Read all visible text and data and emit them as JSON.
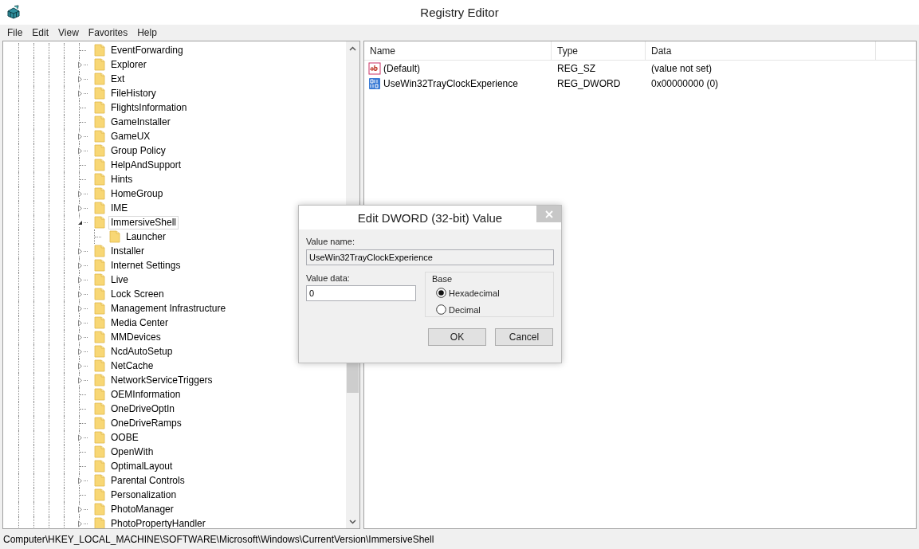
{
  "window": {
    "title": "Registry Editor"
  },
  "menu": [
    "File",
    "Edit",
    "View",
    "Favorites",
    "Help"
  ],
  "tree": {
    "items": [
      {
        "label": "EventForwarding",
        "expandable": false,
        "selected": false
      },
      {
        "label": "Explorer",
        "expandable": true,
        "selected": false
      },
      {
        "label": "Ext",
        "expandable": true,
        "selected": false
      },
      {
        "label": "FileHistory",
        "expandable": true,
        "selected": false
      },
      {
        "label": "FlightsInformation",
        "expandable": false,
        "selected": false
      },
      {
        "label": "GameInstaller",
        "expandable": false,
        "selected": false
      },
      {
        "label": "GameUX",
        "expandable": true,
        "selected": false
      },
      {
        "label": "Group Policy",
        "expandable": true,
        "selected": false
      },
      {
        "label": "HelpAndSupport",
        "expandable": false,
        "selected": false
      },
      {
        "label": "Hints",
        "expandable": false,
        "selected": false
      },
      {
        "label": "HomeGroup",
        "expandable": true,
        "selected": false
      },
      {
        "label": "IME",
        "expandable": true,
        "selected": false
      },
      {
        "label": "ImmersiveShell",
        "expandable": true,
        "expanded": true,
        "selected": true,
        "children": [
          {
            "label": "Launcher",
            "expandable": false,
            "selected": false
          }
        ]
      },
      {
        "label": "Installer",
        "expandable": true,
        "selected": false
      },
      {
        "label": "Internet Settings",
        "expandable": true,
        "selected": false
      },
      {
        "label": "Live",
        "expandable": true,
        "selected": false
      },
      {
        "label": "Lock Screen",
        "expandable": true,
        "selected": false
      },
      {
        "label": "Management Infrastructure",
        "expandable": true,
        "selected": false
      },
      {
        "label": "Media Center",
        "expandable": true,
        "selected": false
      },
      {
        "label": "MMDevices",
        "expandable": true,
        "selected": false
      },
      {
        "label": "NcdAutoSetup",
        "expandable": true,
        "selected": false
      },
      {
        "label": "NetCache",
        "expandable": true,
        "selected": false
      },
      {
        "label": "NetworkServiceTriggers",
        "expandable": true,
        "selected": false
      },
      {
        "label": "OEMInformation",
        "expandable": false,
        "selected": false
      },
      {
        "label": "OneDriveOptIn",
        "expandable": false,
        "selected": false
      },
      {
        "label": "OneDriveRamps",
        "expandable": false,
        "selected": false
      },
      {
        "label": "OOBE",
        "expandable": true,
        "selected": false
      },
      {
        "label": "OpenWith",
        "expandable": false,
        "selected": false
      },
      {
        "label": "OptimalLayout",
        "expandable": false,
        "selected": false
      },
      {
        "label": "Parental Controls",
        "expandable": true,
        "selected": false
      },
      {
        "label": "Personalization",
        "expandable": false,
        "selected": false
      },
      {
        "label": "PhotoManager",
        "expandable": true,
        "selected": false
      },
      {
        "label": "PhotoPropertyHandler",
        "expandable": true,
        "selected": false
      }
    ]
  },
  "values": {
    "columns": [
      "Name",
      "Type",
      "Data"
    ],
    "rows": [
      {
        "kind": "string",
        "name": "(Default)",
        "type": "REG_SZ",
        "data": "(value not set)"
      },
      {
        "kind": "binary",
        "name": "UseWin32TrayClockExperience",
        "type": "REG_DWORD",
        "data": "0x00000000 (0)"
      }
    ]
  },
  "dialog": {
    "title": "Edit DWORD (32-bit) Value",
    "value_name_label": "Value name:",
    "value_name": "UseWin32TrayClockExperience",
    "value_data_label": "Value data:",
    "value_data": "0",
    "base_label": "Base",
    "base_options": [
      {
        "label": "Hexadecimal",
        "selected": true
      },
      {
        "label": "Decimal",
        "selected": false
      }
    ],
    "buttons": [
      "OK",
      "Cancel"
    ]
  },
  "status_bar": "Computer\\HKEY_LOCAL_MACHINE\\SOFTWARE\\Microsoft\\Windows\\CurrentVersion\\ImmersiveShell"
}
